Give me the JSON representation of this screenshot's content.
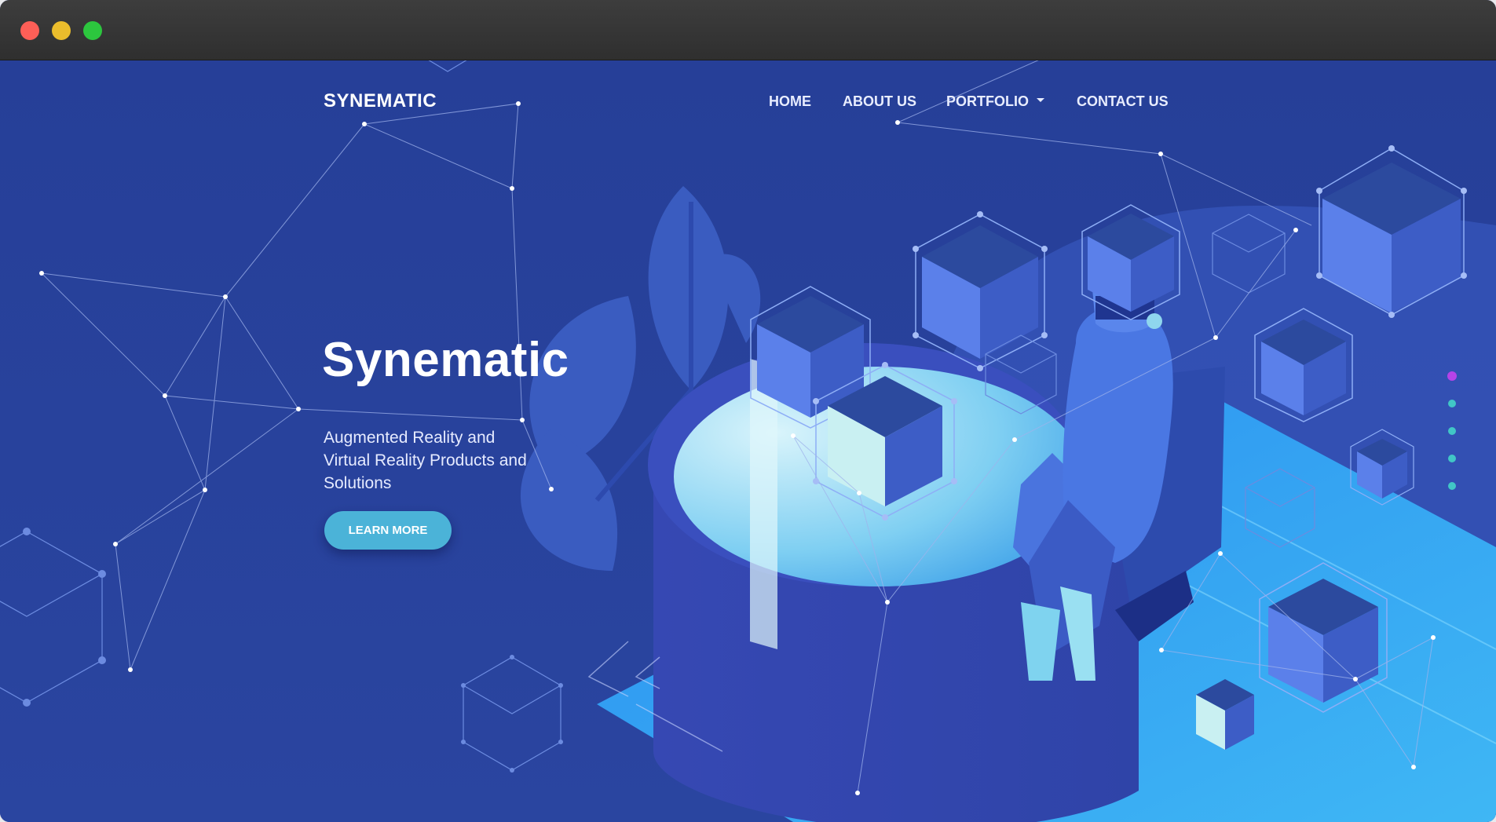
{
  "brand": {
    "name": "SYNEMATIC"
  },
  "nav": {
    "items": [
      {
        "label": "HOME"
      },
      {
        "label": "ABOUT US"
      },
      {
        "label": "PORTFOLIO",
        "has_dropdown": true
      },
      {
        "label": "CONTACT US"
      }
    ]
  },
  "hero": {
    "title": "Synematic",
    "subtitle": "Augmented Reality and Virtual Reality Products and Solutions",
    "cta_label": "LEARN MORE"
  },
  "pager": {
    "count": 5,
    "active_index": 0
  },
  "colors": {
    "background": "#28429a",
    "accent_button": "#4bb3d8",
    "pager_active": "#b543e8",
    "pager_dot": "#41c6c6"
  }
}
